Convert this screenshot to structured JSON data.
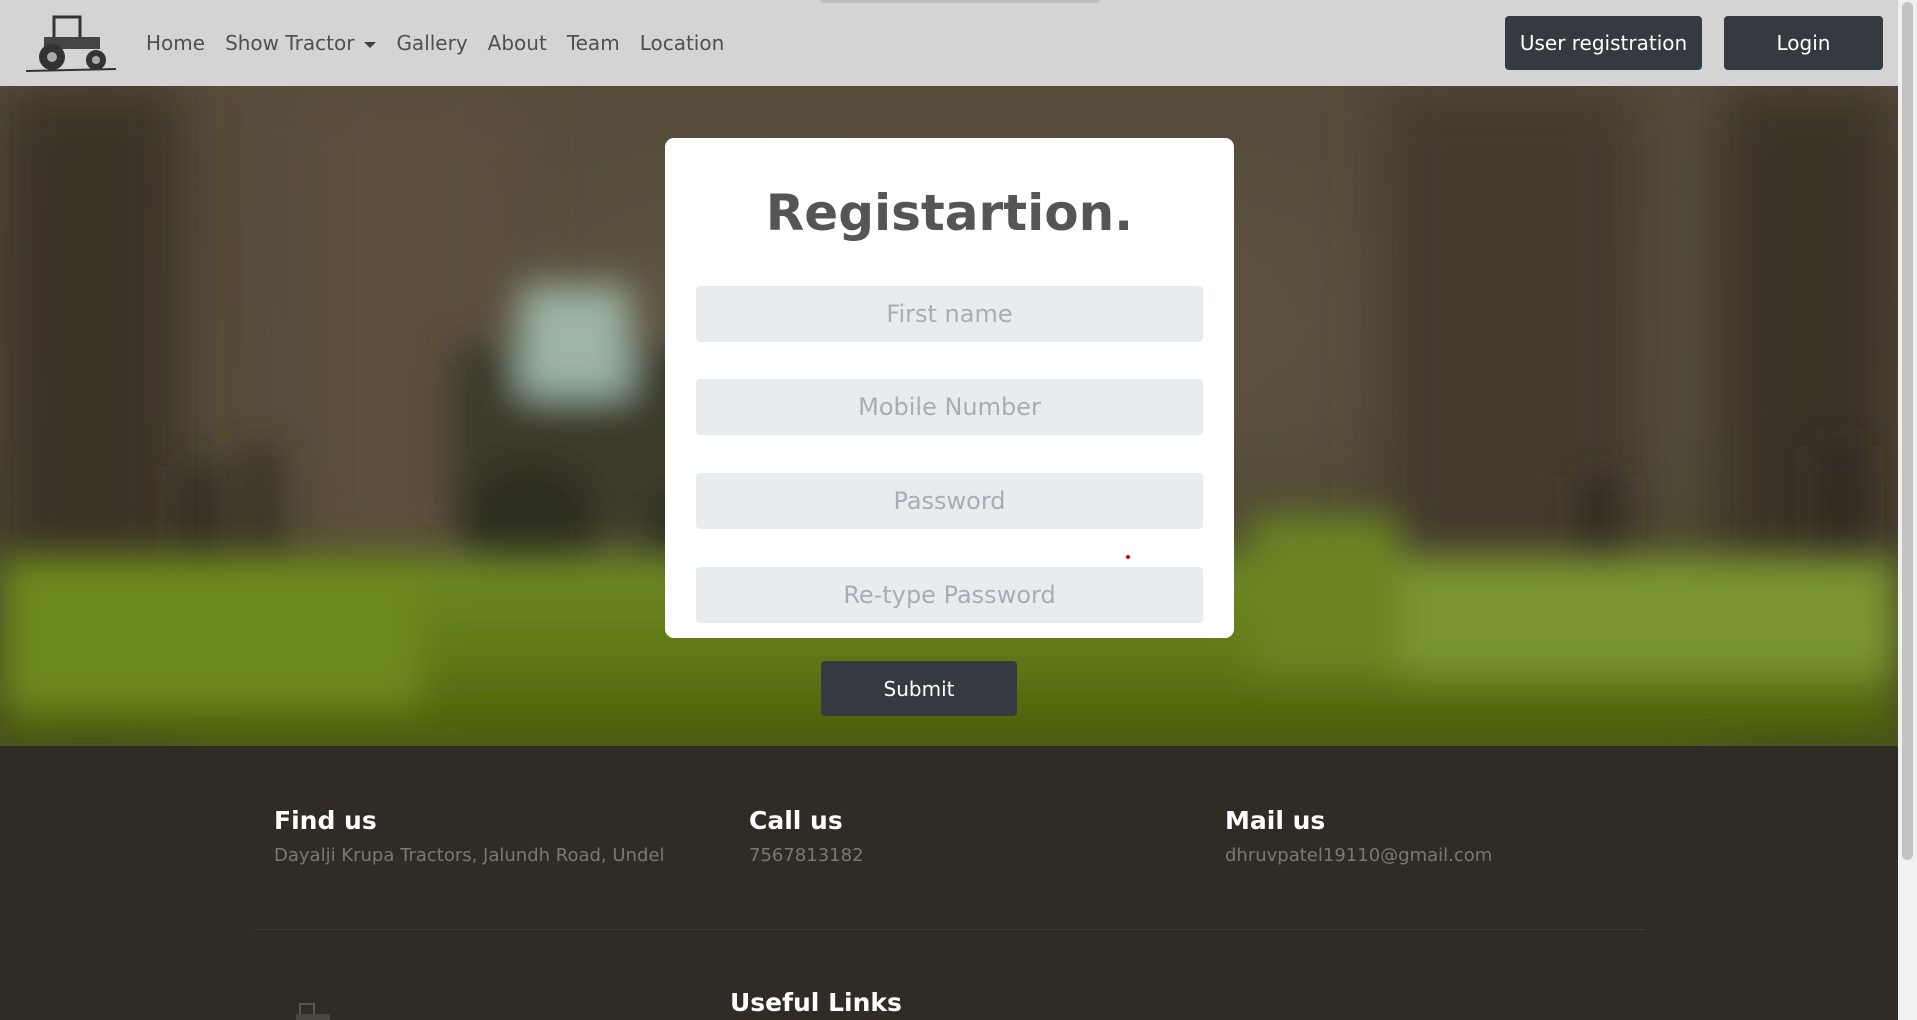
{
  "navbar": {
    "logo_icon": "tractor-logo-icon",
    "links": [
      "Home",
      "Show Tractor",
      "Gallery",
      "About",
      "Team",
      "Location"
    ],
    "user_registration": "User registration",
    "login": "Login"
  },
  "form": {
    "title": "Registartion.",
    "first_name_placeholder": "First name",
    "mobile_placeholder": "Mobile Number",
    "password_placeholder": "Password",
    "retype_placeholder": "Re-type Password",
    "submit": "Submit"
  },
  "footer": {
    "find_heading": "Find us",
    "find_text": "Dayalji Krupa Tractors, Jalundh Road, Undel",
    "call_heading": "Call us",
    "call_text": "7567813182",
    "mail_heading": "Mail us",
    "mail_text": "dhruvpatel19110@gmail.com",
    "useful_heading": "Useful Links"
  },
  "colors": {
    "navbar_bg": "#d4d4d4",
    "button_dark": "#343a40",
    "footer_bg": "#302b25",
    "input_bg": "#e9ecef"
  }
}
